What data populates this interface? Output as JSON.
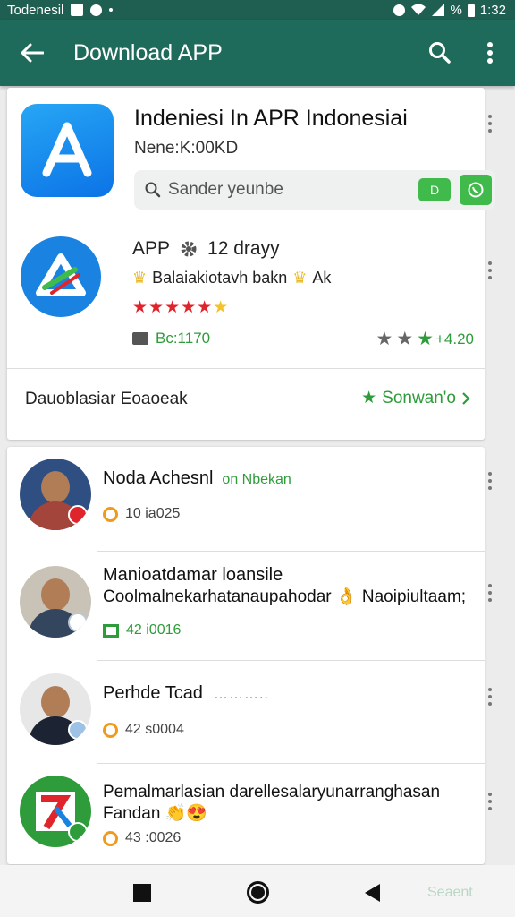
{
  "status_bar": {
    "left_text": "Todenesil",
    "right_text": "%",
    "time": "1:32"
  },
  "toolbar": {
    "title": "Download APP"
  },
  "app_card": {
    "title": "Indeniesi In APR Indonesiai",
    "subtitle": "Nene:K:00KD",
    "search_placeholder": "Sander yeunbe",
    "pill_label": "D"
  },
  "second_app": {
    "name": "APP",
    "days": "12  drayy",
    "desc": "Balaiakiotavh bakn",
    "desc_tag": "Ak",
    "stars_red": "★★★★★",
    "stars_gold": "★",
    "id": "Bc:1170",
    "rating_num": "+4.20"
  },
  "card_footer": {
    "left": "Dauoblasiar Eoaoeak",
    "right": "Sonwan'o"
  },
  "list": [
    {
      "name": "Noda Achesnl",
      "tag": "on Nbekan",
      "meta": "10 ia025"
    },
    {
      "name_line1": "Manioatdamar loansile",
      "name_line2": "Coolmalnekarhatanaupahodar",
      "name_tag": "Naoipiultaam;",
      "meta": "42 i0016"
    },
    {
      "name": "Perhde Tcad",
      "meta": "42 s0004"
    },
    {
      "name_line1": "Pemalmarlasian darellesalaryunarranghasan",
      "name_line2": "Fandan",
      "meta": "43 :0026"
    }
  ],
  "nav_bar": {
    "extra_label": "Seaent"
  },
  "colors": {
    "toolbar": "#1f6b5b",
    "status_bar": "#1f5f52",
    "accent_green": "#2e9c3a",
    "app_blue": "#1a82e0"
  }
}
